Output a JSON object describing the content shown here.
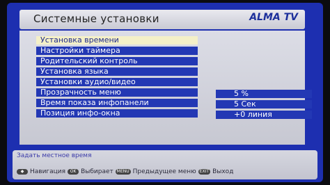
{
  "header": {
    "title": "Системные установки",
    "logo": "ALMA TV"
  },
  "menu": {
    "items": [
      {
        "label": "Установка времени",
        "selected": true
      },
      {
        "label": "Настройки таймера"
      },
      {
        "label": "Родительский контроль"
      },
      {
        "label": "Установка языка"
      },
      {
        "label": "Установки аудио/видео"
      },
      {
        "label": "Прозрачность меню"
      },
      {
        "label": "Время показа инфопанели"
      },
      {
        "label": "Позиция инфо-окна"
      }
    ],
    "values": {
      "transparency": "5 %",
      "info_time": "5 Сек",
      "info_position": "+0 линия"
    }
  },
  "footer": {
    "hint": "Задать местное время",
    "keys": [
      {
        "icon": "nav-arrows-icon",
        "label": "Навигация"
      },
      {
        "icon": "OK",
        "label": "Выбирает"
      },
      {
        "icon": "MENU",
        "label": "Предыдущее меню"
      },
      {
        "icon": "EXIT",
        "label": "Выход"
      }
    ]
  }
}
